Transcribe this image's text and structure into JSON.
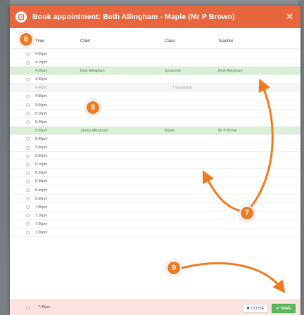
{
  "header": {
    "title": "Book appointment: Beth Allingham - Maple (Mr P Brown)",
    "close_glyph": "✕"
  },
  "table": {
    "headers": [
      "Time",
      "Child",
      "Class",
      "Teacher"
    ]
  },
  "rows": [
    {
      "time": "4:00pm",
      "child": "",
      "class": "",
      "teacher": "",
      "state": "open"
    },
    {
      "time": "4:10pm",
      "child": "",
      "class": "",
      "teacher": "",
      "state": "open"
    },
    {
      "time": "4:20pm",
      "child": "Beth Allingham",
      "class": "Sycamore",
      "teacher": "Beth Allingham",
      "state": "booked"
    },
    {
      "time": "4:30pm",
      "child": "",
      "class": "",
      "teacher": "",
      "state": "open"
    },
    {
      "time": "4:40pm",
      "child": "",
      "class": "",
      "teacher": "",
      "state": "unavailable"
    },
    {
      "time": "4:50pm",
      "child": "",
      "class": "",
      "teacher": "",
      "state": "open"
    },
    {
      "time": "5:00pm",
      "child": "",
      "class": "",
      "teacher": "",
      "state": "open"
    },
    {
      "time": "5:10pm",
      "child": "",
      "class": "",
      "teacher": "",
      "state": "open"
    },
    {
      "time": "5:20pm",
      "child": "",
      "class": "",
      "teacher": "",
      "state": "open"
    },
    {
      "time": "5:30pm",
      "child": "James Allingham",
      "class": "Maple",
      "teacher": "Mr P Brown",
      "state": "booked"
    },
    {
      "time": "5:40pm",
      "child": "",
      "class": "",
      "teacher": "",
      "state": "open"
    },
    {
      "time": "5:50pm",
      "child": "",
      "class": "",
      "teacher": "",
      "state": "open"
    },
    {
      "time": "6:00pm",
      "child": "",
      "class": "",
      "teacher": "",
      "state": "open"
    },
    {
      "time": "6:10pm",
      "child": "",
      "class": "",
      "teacher": "",
      "state": "open"
    },
    {
      "time": "6:20pm",
      "child": "",
      "class": "",
      "teacher": "",
      "state": "open"
    },
    {
      "time": "6:30pm",
      "child": "",
      "class": "",
      "teacher": "",
      "state": "open"
    },
    {
      "time": "6:40pm",
      "child": "",
      "class": "",
      "teacher": "",
      "state": "open"
    },
    {
      "time": "6:50pm",
      "child": "",
      "class": "",
      "teacher": "",
      "state": "open"
    },
    {
      "time": "7:00pm",
      "child": "",
      "class": "",
      "teacher": "",
      "state": "open"
    },
    {
      "time": "7:10pm",
      "child": "",
      "class": "",
      "teacher": "",
      "state": "open"
    },
    {
      "time": "7:20pm",
      "child": "",
      "class": "",
      "teacher": "",
      "state": "open"
    },
    {
      "time": "7:30pm",
      "child": "",
      "class": "",
      "teacher": "",
      "state": "open"
    }
  ],
  "unavailable_label": "Unavailable",
  "footer": {
    "time": "7:40pm",
    "close_label": "CLOSE",
    "close_glyph": "✖",
    "save_label": "SAVE",
    "save_glyph": "✔"
  },
  "markers": [
    "6",
    "7",
    "8",
    "9"
  ],
  "colors": {
    "header": "#e8663d",
    "booked_row": "#dbefd9",
    "save_button": "#5cb85c",
    "marker": "#f07a1f"
  }
}
